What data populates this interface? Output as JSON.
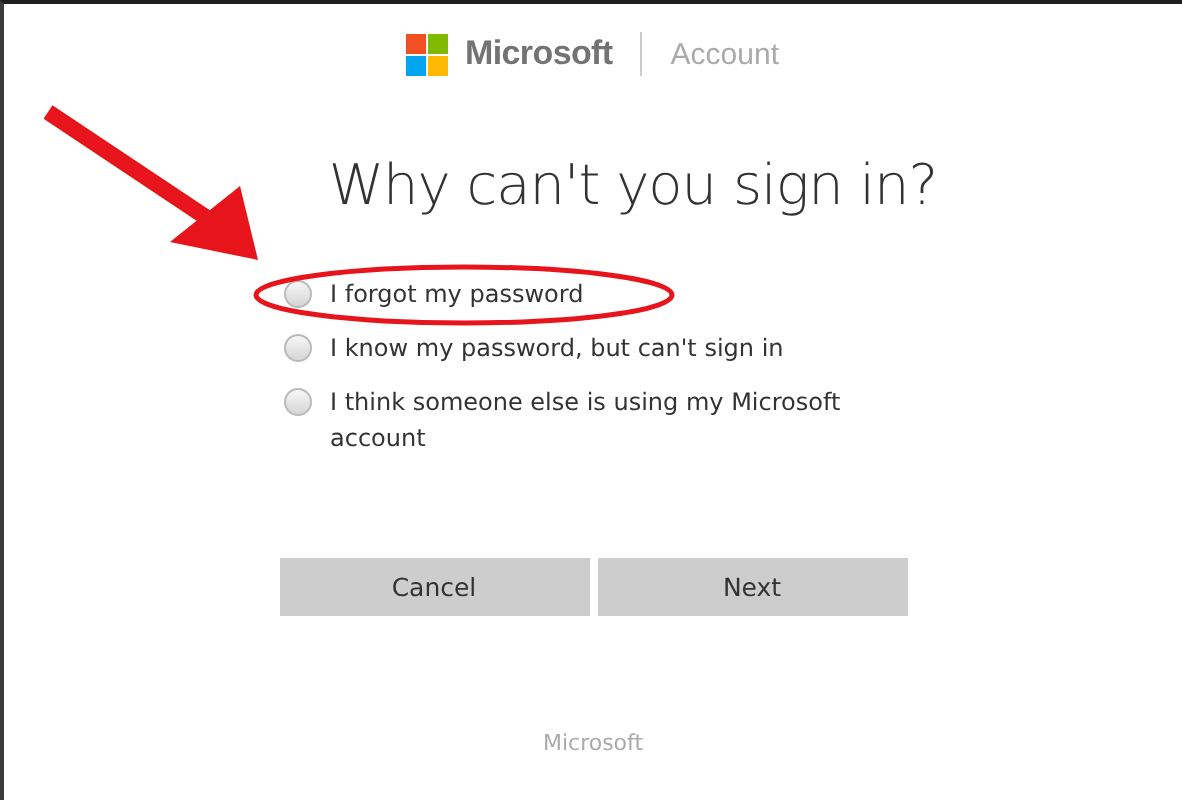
{
  "header": {
    "brand": "Microsoft",
    "section": "Account"
  },
  "title": "Why can't you sign in?",
  "options": [
    {
      "label": "I forgot my password",
      "selected": false,
      "circled": true
    },
    {
      "label": "I know my password, but can't sign in",
      "selected": false,
      "circled": false
    },
    {
      "label": "I think someone else is using my Microsoft account",
      "selected": false,
      "circled": false
    }
  ],
  "buttons": [
    {
      "label": "Cancel"
    },
    {
      "label": "Next"
    }
  ],
  "footer": "Microsoft"
}
